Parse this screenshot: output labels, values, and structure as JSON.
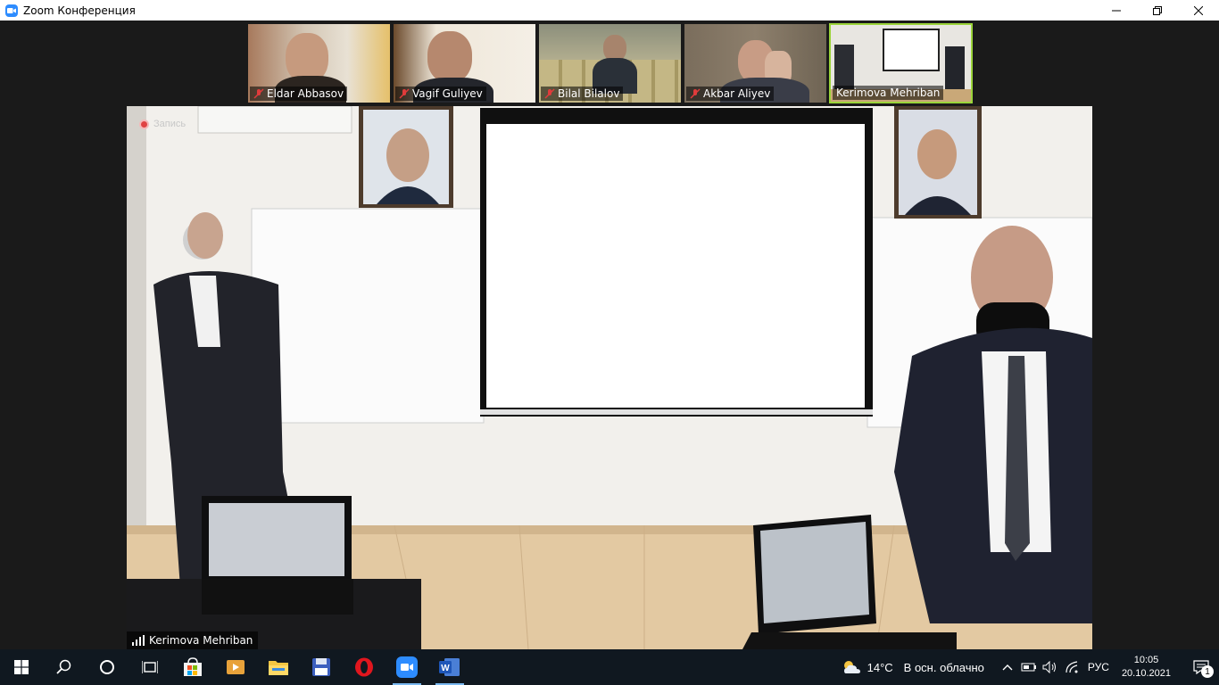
{
  "window": {
    "title": "Zoom Конференция",
    "app_icon": "zoom-camera-icon",
    "controls": [
      "minimize-icon",
      "restore-icon",
      "close-icon"
    ]
  },
  "gallery": [
    {
      "name": "Eldar Abbasov",
      "muted": true,
      "active": false
    },
    {
      "name": "Vagif Guliyev",
      "muted": true,
      "active": false
    },
    {
      "name": "Bilal Bilalov",
      "muted": true,
      "active": false
    },
    {
      "name": "Akbar Aliyev",
      "muted": true,
      "active": false
    },
    {
      "name": "Kerimova Mehriban",
      "muted": false,
      "active": true
    }
  ],
  "main_video": {
    "recording_label": "Запись",
    "speaker_name": "Kerimova Mehriban",
    "signal_icon": "signal-bars-icon"
  },
  "taskbar": {
    "items": [
      {
        "icon": "windows-start-icon",
        "running": false
      },
      {
        "icon": "search-icon",
        "running": false
      },
      {
        "icon": "cortana-icon",
        "running": false
      },
      {
        "icon": "task-view-icon",
        "running": false
      },
      {
        "icon": "microsoft-store-icon",
        "running": false
      },
      {
        "icon": "media-player-icon",
        "running": false
      },
      {
        "icon": "file-explorer-icon",
        "running": false
      },
      {
        "icon": "save-floppy-icon",
        "running": false
      },
      {
        "icon": "opera-icon",
        "running": false
      },
      {
        "icon": "zoom-icon",
        "running": true
      },
      {
        "icon": "word-icon",
        "running": true
      }
    ],
    "weather": {
      "temp": "14°C",
      "desc": "В осн. облачно",
      "icon": "cloud-sun-icon"
    },
    "tray_icons": [
      "chevron-up-icon",
      "battery-icon",
      "volume-icon",
      "wifi-icon"
    ],
    "language": "РУС",
    "time": "10:05",
    "date": "20.10.2021",
    "notifications": "1"
  },
  "colors": {
    "active_tile_border": "#9bd43a",
    "taskbar_bg": "#101820",
    "zoom_blue": "#2d8cff",
    "mute_red": "#e03b3b",
    "opera_red": "#e0161e"
  }
}
